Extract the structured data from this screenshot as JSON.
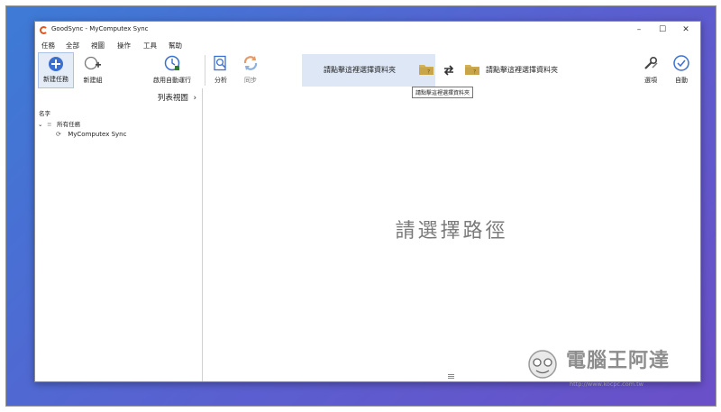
{
  "window": {
    "title": "GoodSync - MyComputex Sync"
  },
  "window_controls": {
    "minimize": "–",
    "maximize": "☐",
    "close": "✕"
  },
  "menu": [
    "任務",
    "全部",
    "視圖",
    "操作",
    "工具",
    "幫助"
  ],
  "toolbar": {
    "new_job": "新建任務",
    "new_group": "新建組",
    "enable_auto": "啟用自動運行",
    "analyze": "分析",
    "sync": "同步",
    "left_folder": "請點擊這裡選擇資料夾",
    "right_folder": "請點擊這裡選擇資料夾",
    "options": "選項",
    "auto": "自動"
  },
  "tooltip": "請點擊這裡選擇資料夾",
  "left_panel": {
    "view_mode": "列表視圖",
    "view_arrow": "›",
    "column_header": "名字",
    "tree_root": "所有任務",
    "tree_item": "MyComputex Sync"
  },
  "main": {
    "placeholder": "請選擇路徑"
  },
  "watermark": {
    "title": "電腦王阿達",
    "url": "http://www.kocpc.com.tw"
  },
  "colors": {
    "accent": "#3b6fd0",
    "folder": "#d4b25a",
    "sync_arrow": "#e07a3a",
    "background_gradient": "#4a6cd4"
  }
}
